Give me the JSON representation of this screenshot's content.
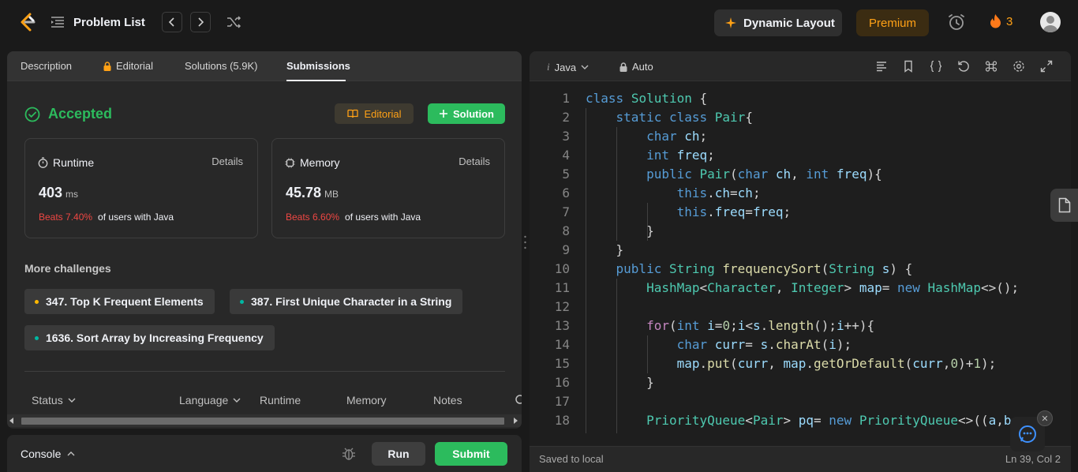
{
  "header": {
    "problem_list_label": "Problem List",
    "dynamic_layout_label": "Dynamic Layout",
    "premium_label": "Premium",
    "streak_count": "3",
    "icons": [
      "logo-icon",
      "list-icon",
      "chevron-left-icon",
      "chevron-right-icon",
      "shuffle-icon",
      "sparkle-icon",
      "alarm-icon",
      "flame-icon",
      "avatar"
    ]
  },
  "left_tabs": [
    {
      "label": "Description"
    },
    {
      "label": "Editorial"
    },
    {
      "label": "Solutions (5.9K)"
    },
    {
      "label": "Submissions"
    }
  ],
  "result": {
    "status": "Accepted",
    "editorial_button": "Editorial",
    "solution_button": "Solution",
    "runtime": {
      "title": "Runtime",
      "details": "Details",
      "value": "403",
      "unit": "ms",
      "beats": "Beats 7.40%",
      "suffix": "of users with Java"
    },
    "memory": {
      "title": "Memory",
      "details": "Details",
      "value": "45.78",
      "unit": "MB",
      "beats": "Beats 6.60%",
      "suffix": "of users with Java"
    }
  },
  "challenges": {
    "heading": "More challenges",
    "items": [
      {
        "label": "347. Top K Frequent Elements",
        "dot_color": "#ffb800"
      },
      {
        "label": "387. First Unique Character in a String",
        "dot_color": "#00b8a3"
      },
      {
        "label": "1636. Sort Array by Increasing Frequency",
        "dot_color": "#00b8a3"
      }
    ]
  },
  "table_headers": [
    "Status",
    "Language",
    "Runtime",
    "Memory",
    "Notes"
  ],
  "console": {
    "label": "Console",
    "run": "Run",
    "submit": "Submit"
  },
  "editor": {
    "language": "Java",
    "auto_label": "Auto",
    "saved_label": "Saved to local",
    "cursor_pos": "Ln 39, Col 2",
    "line_numbers": [
      "1",
      "2",
      "3",
      "4",
      "5",
      "6",
      "7",
      "8",
      "9",
      "10",
      "11",
      "12",
      "13",
      "14",
      "15",
      "16",
      "17",
      "18"
    ],
    "code": [
      "class Solution {",
      "    static class Pair{",
      "        char ch;",
      "        int freq;",
      "        public Pair(char ch, int freq){",
      "            this.ch=ch;",
      "            this.freq=freq;",
      "        }",
      "    }",
      "    public String frequencySort(String s) {",
      "        HashMap<Character, Integer> map= new HashMap<>();",
      "",
      "        for(int i=0;i<s.length();i++){",
      "            char curr= s.charAt(i);",
      "            map.put(curr, map.getOrDefault(curr,0)+1);",
      "        }",
      "",
      "        PriorityQueue<Pair> pq= new PriorityQueue<>((a,b"
    ]
  },
  "colors": {
    "accent_green": "#2cbb5d",
    "accent_orange": "#ffa116",
    "beats_red": "#ef4743"
  }
}
